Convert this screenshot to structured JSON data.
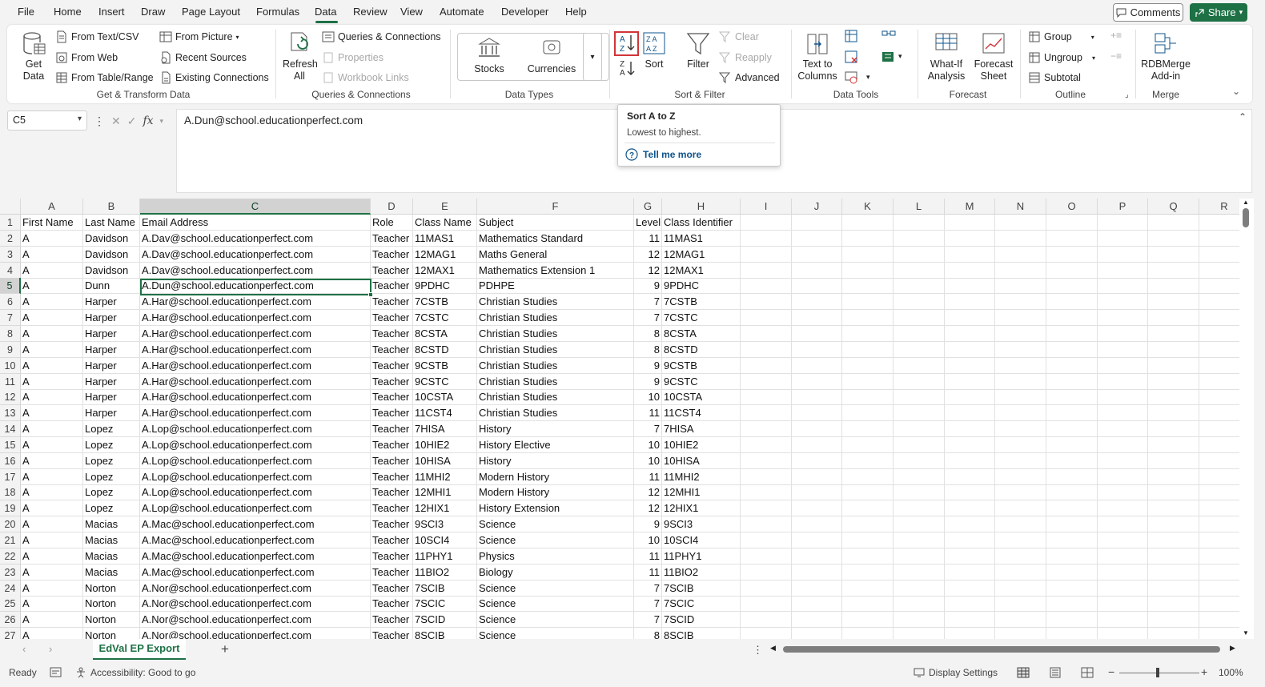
{
  "menu": {
    "items": [
      "File",
      "Home",
      "Insert",
      "Draw",
      "Page Layout",
      "Formulas",
      "Data",
      "Review",
      "View",
      "Automate",
      "Developer",
      "Help"
    ],
    "active": "Data",
    "comments_label": "Comments",
    "share_label": "Share"
  },
  "ribbon": {
    "get_transform": {
      "get_data": "Get Data",
      "from_text_csv": "From Text/CSV",
      "from_web": "From Web",
      "from_table_range": "From Table/Range",
      "from_picture": "From Picture",
      "recent_sources": "Recent Sources",
      "existing_connections": "Existing Connections",
      "label": "Get & Transform Data"
    },
    "queries": {
      "refresh_all": "Refresh All",
      "queries_connections": "Queries & Connections",
      "properties": "Properties",
      "workbook_links": "Workbook Links",
      "label": "Queries & Connections"
    },
    "data_types": {
      "stocks": "Stocks",
      "currencies": "Currencies",
      "label": "Data Types"
    },
    "sort_filter": {
      "sort": "Sort",
      "filter": "Filter",
      "clear": "Clear",
      "reapply": "Reapply",
      "advanced": "Advanced",
      "label": "Sort & Filter"
    },
    "data_tools": {
      "text_to_columns": "Text to Columns",
      "label": "Data Tools"
    },
    "forecast": {
      "what_if": "What-If Analysis",
      "forecast_sheet": "Forecast Sheet",
      "label": "Forecast"
    },
    "outline": {
      "group": "Group",
      "ungroup": "Ungroup",
      "subtotal": "Subtotal",
      "label": "Outline"
    },
    "merge": {
      "rdbmerge": "RDBMerge Add-in",
      "label": "Merge"
    }
  },
  "formula_bar": {
    "name_box": "C5",
    "formula": "A.Dun@school.educationperfect.com"
  },
  "tooltip": {
    "title": "Sort A to Z",
    "description": "Lowest to highest.",
    "link": "Tell me more"
  },
  "columns": [
    "A",
    "B",
    "C",
    "D",
    "E",
    "F",
    "G",
    "H",
    "I",
    "J",
    "K",
    "L",
    "M",
    "N",
    "O",
    "P",
    "Q",
    "R"
  ],
  "rows": [
    [
      "First Name",
      "Last Name",
      "Email Address",
      "Role",
      "Class Name",
      "Subject",
      "Level",
      "Class Identifier"
    ],
    [
      "A",
      "Davidson",
      "A.Dav@school.educationperfect.com",
      "Teacher",
      "11MAS1",
      "Mathematics Standard",
      "11",
      "11MAS1"
    ],
    [
      "A",
      "Davidson",
      "A.Dav@school.educationperfect.com",
      "Teacher",
      "12MAG1",
      "Maths General",
      "12",
      "12MAG1"
    ],
    [
      "A",
      "Davidson",
      "A.Dav@school.educationperfect.com",
      "Teacher",
      "12MAX1",
      "Mathematics Extension 1",
      "12",
      "12MAX1"
    ],
    [
      "A",
      "Dunn",
      "A.Dun@school.educationperfect.com",
      "Teacher",
      "9PDHC",
      "PDHPE",
      "9",
      "9PDHC"
    ],
    [
      "A",
      "Harper",
      "A.Har@school.educationperfect.com",
      "Teacher",
      "7CSTB",
      "Christian Studies",
      "7",
      "7CSTB"
    ],
    [
      "A",
      "Harper",
      "A.Har@school.educationperfect.com",
      "Teacher",
      "7CSTC",
      "Christian Studies",
      "7",
      "7CSTC"
    ],
    [
      "A",
      "Harper",
      "A.Har@school.educationperfect.com",
      "Teacher",
      "8CSTA",
      "Christian Studies",
      "8",
      "8CSTA"
    ],
    [
      "A",
      "Harper",
      "A.Har@school.educationperfect.com",
      "Teacher",
      "8CSTD",
      "Christian Studies",
      "8",
      "8CSTD"
    ],
    [
      "A",
      "Harper",
      "A.Har@school.educationperfect.com",
      "Teacher",
      "9CSTB",
      "Christian Studies",
      "9",
      "9CSTB"
    ],
    [
      "A",
      "Harper",
      "A.Har@school.educationperfect.com",
      "Teacher",
      "9CSTC",
      "Christian Studies",
      "9",
      "9CSTC"
    ],
    [
      "A",
      "Harper",
      "A.Har@school.educationperfect.com",
      "Teacher",
      "10CSTA",
      "Christian Studies",
      "10",
      "10CSTA"
    ],
    [
      "A",
      "Harper",
      "A.Har@school.educationperfect.com",
      "Teacher",
      "11CST4",
      "Christian Studies",
      "11",
      "11CST4"
    ],
    [
      "A",
      "Lopez",
      "A.Lop@school.educationperfect.com",
      "Teacher",
      "7HISA",
      "History",
      "7",
      "7HISA"
    ],
    [
      "A",
      "Lopez",
      "A.Lop@school.educationperfect.com",
      "Teacher",
      "10HIE2",
      "History Elective",
      "10",
      "10HIE2"
    ],
    [
      "A",
      "Lopez",
      "A.Lop@school.educationperfect.com",
      "Teacher",
      "10HISA",
      "History",
      "10",
      "10HISA"
    ],
    [
      "A",
      "Lopez",
      "A.Lop@school.educationperfect.com",
      "Teacher",
      "11MHI2",
      "Modern History",
      "11",
      "11MHI2"
    ],
    [
      "A",
      "Lopez",
      "A.Lop@school.educationperfect.com",
      "Teacher",
      "12MHI1",
      "Modern History",
      "12",
      "12MHI1"
    ],
    [
      "A",
      "Lopez",
      "A.Lop@school.educationperfect.com",
      "Teacher",
      "12HIX1",
      "History Extension",
      "12",
      "12HIX1"
    ],
    [
      "A",
      "Macias",
      "A.Mac@school.educationperfect.com",
      "Teacher",
      "9SCI3",
      "Science",
      "9",
      "9SCI3"
    ],
    [
      "A",
      "Macias",
      "A.Mac@school.educationperfect.com",
      "Teacher",
      "10SCI4",
      "Science",
      "10",
      "10SCI4"
    ],
    [
      "A",
      "Macias",
      "A.Mac@school.educationperfect.com",
      "Teacher",
      "11PHY1",
      "Physics",
      "11",
      "11PHY1"
    ],
    [
      "A",
      "Macias",
      "A.Mac@school.educationperfect.com",
      "Teacher",
      "11BIO2",
      "Biology",
      "11",
      "11BIO2"
    ],
    [
      "A",
      "Norton",
      "A.Nor@school.educationperfect.com",
      "Teacher",
      "7SCIB",
      "Science",
      "7",
      "7SCIB"
    ],
    [
      "A",
      "Norton",
      "A.Nor@school.educationperfect.com",
      "Teacher",
      "7SCIC",
      "Science",
      "7",
      "7SCIC"
    ],
    [
      "A",
      "Norton",
      "A.Nor@school.educationperfect.com",
      "Teacher",
      "7SCID",
      "Science",
      "7",
      "7SCID"
    ],
    [
      "A",
      "Norton",
      "A.Nor@school.educationperfect.com",
      "Teacher",
      "8SCIB",
      "Science",
      "8",
      "8SCIB"
    ]
  ],
  "sheet_tab": "EdVal EP Export",
  "status": {
    "ready": "Ready",
    "accessibility": "Accessibility: Good to go",
    "display_settings": "Display Settings",
    "zoom": "100%"
  },
  "colors": {
    "accent": "#1e7145",
    "highlight": "#d13438",
    "link": "#0f548c"
  }
}
